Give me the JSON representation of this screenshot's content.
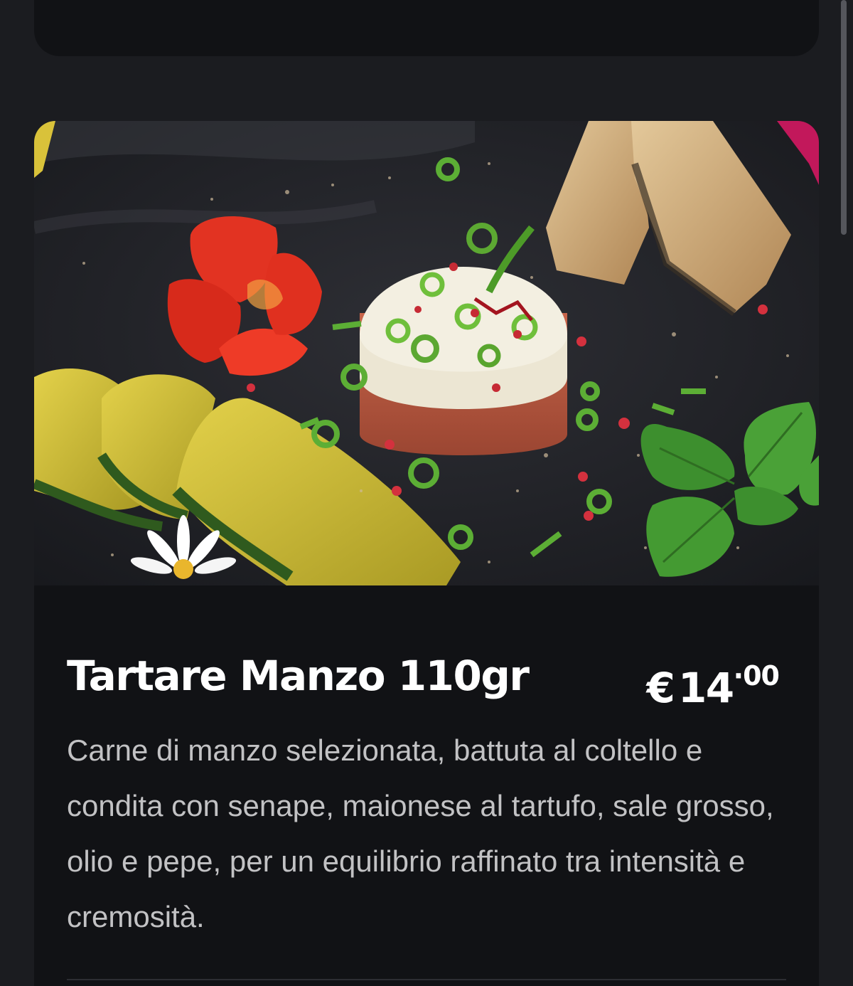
{
  "menu_item": {
    "name": "Tartare Manzo 110gr",
    "price_currency": "€",
    "price_main": "14",
    "price_separator": "·",
    "price_cents": "00",
    "description": "Carne di manzo selezionata, battuta al coltello e condita con senape, maionese al tartufo, sale grosso, olio e pepe, per un equilibrio raffinato tra intensità e cremosità."
  },
  "colors": {
    "background": "#1b1c20",
    "card": "#111215",
    "title": "#ffffff",
    "description": "#c2c2c4"
  }
}
